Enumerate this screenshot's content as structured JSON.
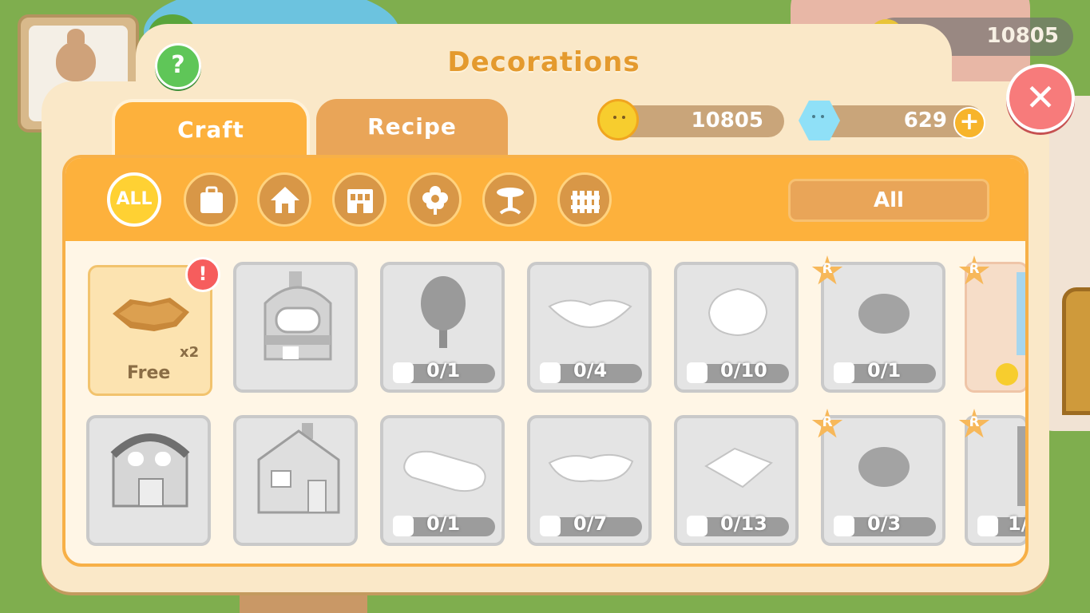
{
  "header": {
    "title": "Decorations",
    "help_label": "?",
    "close_label": "✕",
    "background_gold": "10805"
  },
  "tabs": [
    {
      "label": "Craft",
      "active": true
    },
    {
      "label": "Recipe",
      "active": false
    }
  ],
  "currency": {
    "gold": "10805",
    "gems": "629",
    "add_label": "+"
  },
  "categories": [
    {
      "label": "ALL",
      "icon": "all-icon",
      "active": true
    },
    {
      "icon": "luggage-icon"
    },
    {
      "icon": "house-icon"
    },
    {
      "icon": "shop-icon"
    },
    {
      "icon": "flower-icon"
    },
    {
      "icon": "table-icon"
    },
    {
      "icon": "fence-icon"
    }
  ],
  "filter": {
    "selected": "All"
  },
  "items_row1": [
    {
      "type": "free",
      "label": "Free",
      "qty": "x2",
      "alert": "!",
      "icon": "dirt-patch-icon"
    },
    {
      "type": "building",
      "icon": "bakery-icon"
    },
    {
      "type": "progress",
      "icon": "tree-icon",
      "progress": "0/1"
    },
    {
      "type": "progress",
      "icon": "lips-tile-icon",
      "progress": "0/4"
    },
    {
      "type": "progress",
      "icon": "leaf-tile-icon",
      "progress": "0/10"
    },
    {
      "type": "progress",
      "icon": "bush-icon",
      "progress": "0/1",
      "badge": "R"
    },
    {
      "type": "partial",
      "badge": "R",
      "icon": "lamp-icon"
    }
  ],
  "items_row2": [
    {
      "type": "building",
      "icon": "barn-icon"
    },
    {
      "type": "building",
      "icon": "cottage-icon"
    },
    {
      "type": "progress",
      "icon": "oval-tile-icon",
      "progress": "0/1"
    },
    {
      "type": "progress",
      "icon": "wave-tile-icon",
      "progress": "0/7"
    },
    {
      "type": "progress",
      "icon": "diamond-tile-icon",
      "progress": "0/13"
    },
    {
      "type": "progress",
      "icon": "bush-icon",
      "progress": "0/3",
      "badge": "R"
    },
    {
      "type": "partial",
      "badge": "R",
      "icon": "post-icon",
      "progress": "1/"
    }
  ],
  "colors": {
    "accent": "#fdb13c",
    "panel": "#fae8c8",
    "close": "#f77b7b",
    "help": "#5fc658"
  }
}
